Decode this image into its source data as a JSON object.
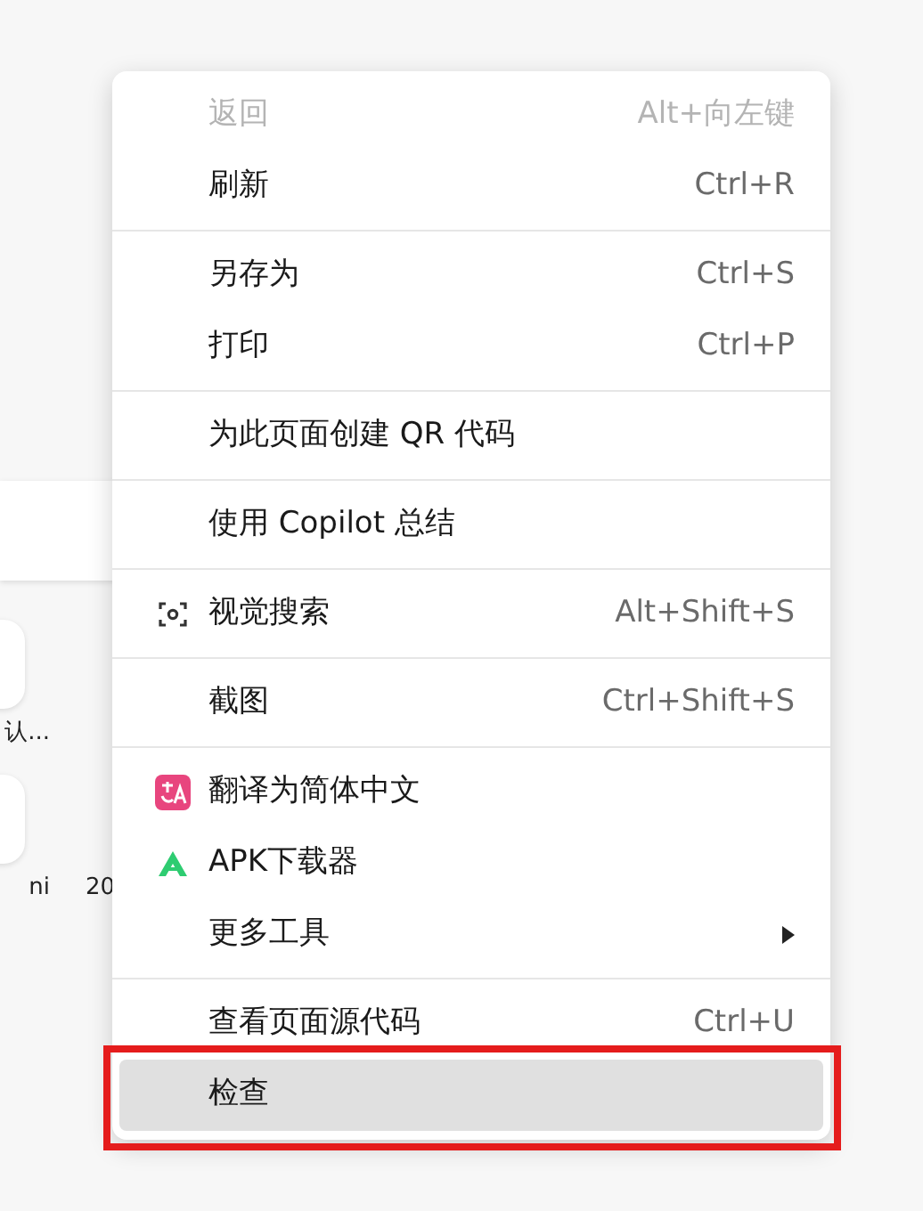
{
  "background": {
    "tiles": [
      {
        "label": "认..."
      },
      {
        "label": "ni"
      }
    ],
    "extra_label": "20"
  },
  "context_menu": {
    "sections": [
      [
        {
          "label": "返回",
          "shortcut": "Alt+向左键",
          "kind": "plain",
          "disabled": true,
          "selected": false,
          "submenu": false
        },
        {
          "label": "刷新",
          "shortcut": "Ctrl+R",
          "kind": "plain",
          "disabled": false,
          "selected": false,
          "submenu": false
        }
      ],
      [
        {
          "label": "另存为",
          "shortcut": "Ctrl+S",
          "kind": "plain",
          "disabled": false,
          "selected": false,
          "submenu": false
        },
        {
          "label": "打印",
          "shortcut": "Ctrl+P",
          "kind": "plain",
          "disabled": false,
          "selected": false,
          "submenu": false
        }
      ],
      [
        {
          "label": "为此页面创建 QR 代码",
          "kind": "plain",
          "disabled": false,
          "selected": false,
          "submenu": false
        }
      ],
      [
        {
          "label": "使用 Copilot 总结",
          "kind": "plain",
          "disabled": false,
          "selected": false,
          "submenu": false
        }
      ],
      [
        {
          "label": "视觉搜索",
          "shortcut": "Alt+Shift+S",
          "kind": "scan",
          "disabled": false,
          "selected": false,
          "submenu": false
        }
      ],
      [
        {
          "label": "截图",
          "shortcut": "Ctrl+Shift+S",
          "kind": "plain",
          "disabled": false,
          "selected": false,
          "submenu": false
        }
      ],
      [
        {
          "label": "翻译为简体中文",
          "kind": "translate",
          "disabled": false,
          "selected": false,
          "submenu": false
        },
        {
          "label": "APK下载器",
          "kind": "apk",
          "disabled": false,
          "selected": false,
          "submenu": false
        },
        {
          "label": "更多工具",
          "kind": "plain",
          "disabled": false,
          "selected": false,
          "submenu": true
        }
      ],
      [
        {
          "label": "查看页面源代码",
          "shortcut": "Ctrl+U",
          "kind": "plain",
          "disabled": false,
          "selected": false,
          "submenu": false
        },
        {
          "label": "检查",
          "kind": "plain",
          "disabled": false,
          "selected": true,
          "submenu": false,
          "highlighted": true
        }
      ]
    ]
  }
}
